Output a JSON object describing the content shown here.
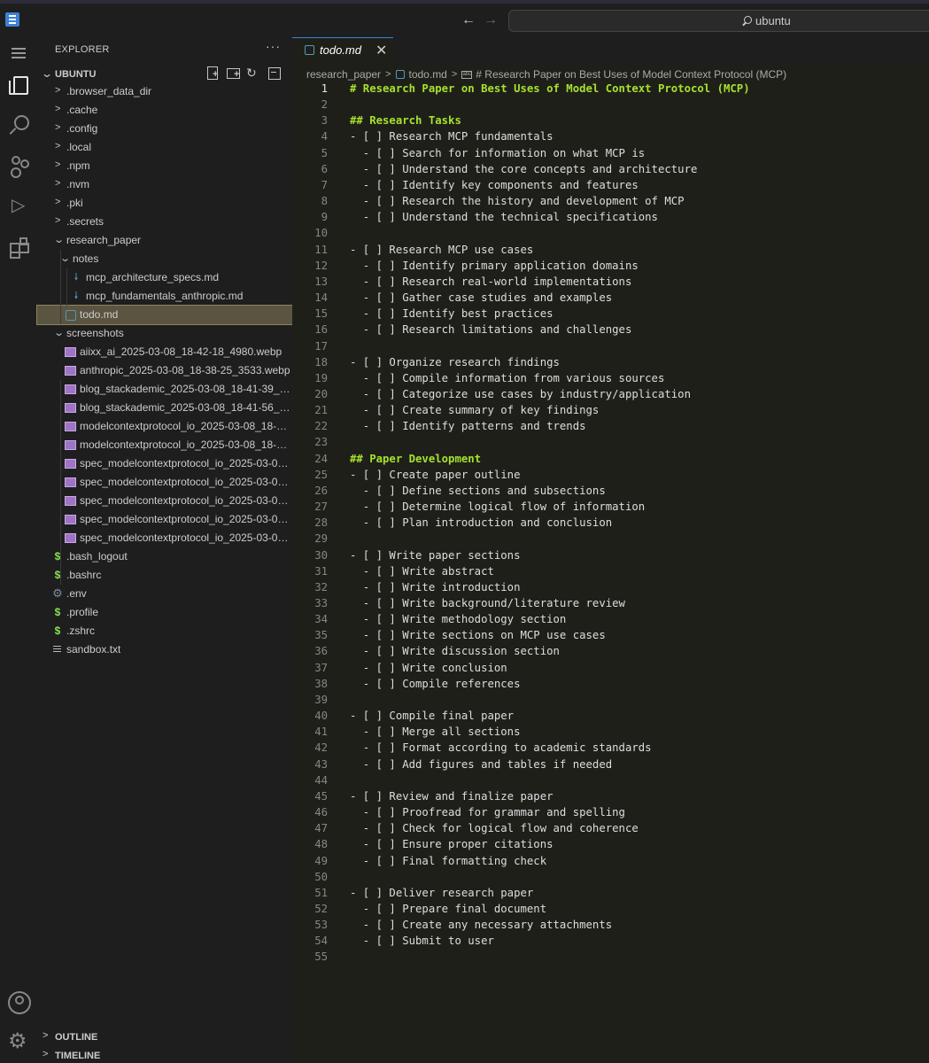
{
  "titlebar": {
    "search_label": "ubuntu"
  },
  "sidebar": {
    "title": "EXPLORER",
    "more": "···",
    "root": "UBUNTU",
    "refresh_glyph": "↻",
    "tree": [
      {
        "label": ".browser_data_dir",
        "kind": "folder",
        "depth": 0,
        "state": "collapsed"
      },
      {
        "label": ".cache",
        "kind": "folder",
        "depth": 0,
        "state": "collapsed"
      },
      {
        "label": ".config",
        "kind": "folder",
        "depth": 0,
        "state": "collapsed"
      },
      {
        "label": ".local",
        "kind": "folder",
        "depth": 0,
        "state": "collapsed"
      },
      {
        "label": ".npm",
        "kind": "folder",
        "depth": 0,
        "state": "collapsed"
      },
      {
        "label": ".nvm",
        "kind": "folder",
        "depth": 0,
        "state": "collapsed"
      },
      {
        "label": ".pki",
        "kind": "folder",
        "depth": 0,
        "state": "collapsed"
      },
      {
        "label": ".secrets",
        "kind": "folder",
        "depth": 0,
        "state": "collapsed"
      },
      {
        "label": "research_paper",
        "kind": "folder",
        "depth": 0,
        "state": "expanded"
      },
      {
        "label": "notes",
        "kind": "folder",
        "depth": 1,
        "state": "expanded"
      },
      {
        "label": "mcp_architecture_specs.md",
        "kind": "md",
        "depth": 2
      },
      {
        "label": "mcp_fundamentals_anthropic.md",
        "kind": "md",
        "depth": 2
      },
      {
        "label": "todo.md",
        "kind": "todo",
        "depth": 1,
        "selected": true
      },
      {
        "label": "screenshots",
        "kind": "folder",
        "depth": 0,
        "state": "expanded"
      },
      {
        "label": "aiixx_ai_2025-03-08_18-42-18_4980.webp",
        "kind": "img",
        "depth": 1
      },
      {
        "label": "anthropic_2025-03-08_18-38-25_3533.webp",
        "kind": "img",
        "depth": 1
      },
      {
        "label": "blog_stackademic_2025-03-08_18-41-39_5...",
        "kind": "img",
        "depth": 1
      },
      {
        "label": "blog_stackademic_2025-03-08_18-41-56_7...",
        "kind": "img",
        "depth": 1
      },
      {
        "label": "modelcontextprotocol_io_2025-03-08_18-4...",
        "kind": "img",
        "depth": 1
      },
      {
        "label": "modelcontextprotocol_io_2025-03-08_18-4...",
        "kind": "img",
        "depth": 1
      },
      {
        "label": "spec_modelcontextprotocol_io_2025-03-08...",
        "kind": "img",
        "depth": 1
      },
      {
        "label": "spec_modelcontextprotocol_io_2025-03-08...",
        "kind": "img",
        "depth": 1
      },
      {
        "label": "spec_modelcontextprotocol_io_2025-03-08...",
        "kind": "img",
        "depth": 1
      },
      {
        "label": "spec_modelcontextprotocol_io_2025-03-08...",
        "kind": "img",
        "depth": 1
      },
      {
        "label": "spec_modelcontextprotocol_io_2025-03-08...",
        "kind": "img",
        "depth": 1
      },
      {
        "label": ".bash_logout",
        "kind": "shell",
        "depth": 0
      },
      {
        "label": ".bashrc",
        "kind": "shell",
        "depth": 0
      },
      {
        "label": ".env",
        "kind": "gear",
        "depth": 0
      },
      {
        "label": ".profile",
        "kind": "shell",
        "depth": 0
      },
      {
        "label": ".zshrc",
        "kind": "shell",
        "depth": 0
      },
      {
        "label": "sandbox.txt",
        "kind": "txt",
        "depth": 0
      }
    ],
    "outline": "OUTLINE",
    "timeline": "TIMELINE"
  },
  "editor": {
    "tab_label": "todo.md",
    "tab_close": "✕",
    "breadcrumb": {
      "folder": "research_paper",
      "file": "todo.md",
      "symbol": "# Research Paper on Best Uses of Model Context Protocol (MCP)"
    },
    "active_line": 1,
    "lines": [
      "# Research Paper on Best Uses of Model Context Protocol (MCP)",
      "",
      "## Research Tasks",
      "- [ ] Research MCP fundamentals",
      "  - [ ] Search for information on what MCP is",
      "  - [ ] Understand the core concepts and architecture",
      "  - [ ] Identify key components and features",
      "  - [ ] Research the history and development of MCP",
      "  - [ ] Understand the technical specifications",
      "",
      "- [ ] Research MCP use cases",
      "  - [ ] Identify primary application domains",
      "  - [ ] Research real-world implementations",
      "  - [ ] Gather case studies and examples",
      "  - [ ] Identify best practices",
      "  - [ ] Research limitations and challenges",
      "",
      "- [ ] Organize research findings",
      "  - [ ] Compile information from various sources",
      "  - [ ] Categorize use cases by industry/application",
      "  - [ ] Create summary of key findings",
      "  - [ ] Identify patterns and trends",
      "",
      "## Paper Development",
      "- [ ] Create paper outline",
      "  - [ ] Define sections and subsections",
      "  - [ ] Determine logical flow of information",
      "  - [ ] Plan introduction and conclusion",
      "",
      "- [ ] Write paper sections",
      "  - [ ] Write abstract",
      "  - [ ] Write introduction",
      "  - [ ] Write background/literature review",
      "  - [ ] Write methodology section",
      "  - [ ] Write sections on MCP use cases",
      "  - [ ] Write discussion section",
      "  - [ ] Write conclusion",
      "  - [ ] Compile references",
      "",
      "- [ ] Compile final paper",
      "  - [ ] Merge all sections",
      "  - [ ] Format according to academic standards",
      "  - [ ] Add figures and tables if needed",
      "",
      "- [ ] Review and finalize paper",
      "  - [ ] Proofread for grammar and spelling",
      "  - [ ] Check for logical flow and coherence",
      "  - [ ] Ensure proper citations",
      "  - [ ] Final formatting check",
      "",
      "- [ ] Deliver research paper",
      "  - [ ] Prepare final document",
      "  - [ ] Create any necessary attachments",
      "  - [ ] Submit to user",
      ""
    ]
  },
  "colors": {
    "heading": "#a6e22e",
    "accent": "#3b82d6",
    "selection": "#5a5440"
  }
}
